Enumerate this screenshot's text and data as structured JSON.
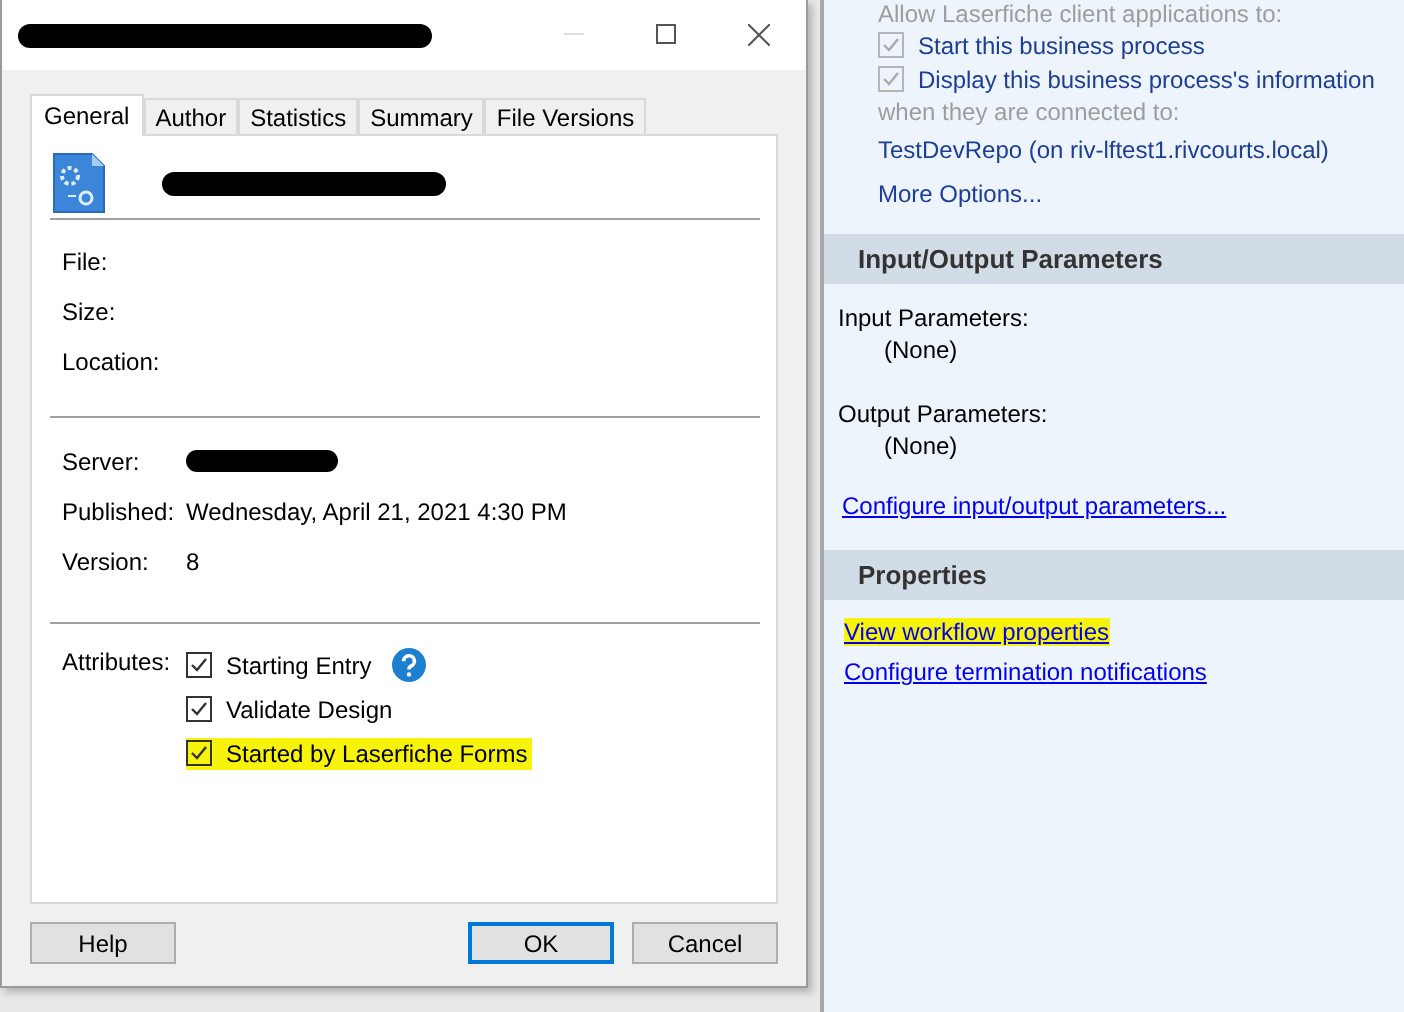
{
  "dialog": {
    "tabs": [
      {
        "label": "General",
        "selected": true
      },
      {
        "label": "Author",
        "selected": false
      },
      {
        "label": "Statistics",
        "selected": false
      },
      {
        "label": "Summary",
        "selected": false
      },
      {
        "label": "File Versions",
        "selected": false
      }
    ],
    "file_fields": [
      {
        "label": "File:"
      },
      {
        "label": "Size:"
      },
      {
        "label": "Location:"
      }
    ],
    "server_fields": [
      {
        "label": "Server:",
        "redacted": true
      },
      {
        "label": "Published:",
        "value": "Wednesday, April 21, 2021 4:30 PM"
      },
      {
        "label": "Version:",
        "value": "8"
      }
    ],
    "attributes_label": "Attributes:",
    "attributes": [
      {
        "label": "Starting Entry",
        "checked": true,
        "highlighted": false,
        "help": true
      },
      {
        "label": "Validate Design",
        "checked": true,
        "highlighted": false,
        "help": false
      },
      {
        "label": "Started by Laserfiche Forms",
        "checked": true,
        "highlighted": true,
        "help": false
      }
    ],
    "buttons": [
      {
        "label": "Help",
        "default": false
      },
      {
        "label": "OK",
        "default": true
      },
      {
        "label": "Cancel",
        "default": false
      }
    ]
  },
  "side_panel": {
    "allow_label": "Allow Laserfiche client applications to:",
    "options": [
      {
        "label": "Start this business process",
        "checked": true,
        "disabled": true
      },
      {
        "label": "Display this business process's information",
        "checked": true,
        "disabled": true
      }
    ],
    "connected_label": "when they are connected to:",
    "repository": "TestDevRepo (on riv-lftest1.rivcourts.local)",
    "more_options": "More Options...",
    "io_section": {
      "title": "Input/Output Parameters",
      "params": [
        {
          "label": "Input Parameters:",
          "value": "(None)"
        },
        {
          "label": "Output Parameters:",
          "value": "(None)"
        }
      ],
      "link": "Configure input/output parameters..."
    },
    "properties_section": {
      "title": "Properties",
      "links": [
        {
          "label": "View workflow properties",
          "highlighted": true
        },
        {
          "label": "Configure termination notifications",
          "highlighted": false
        }
      ]
    }
  }
}
